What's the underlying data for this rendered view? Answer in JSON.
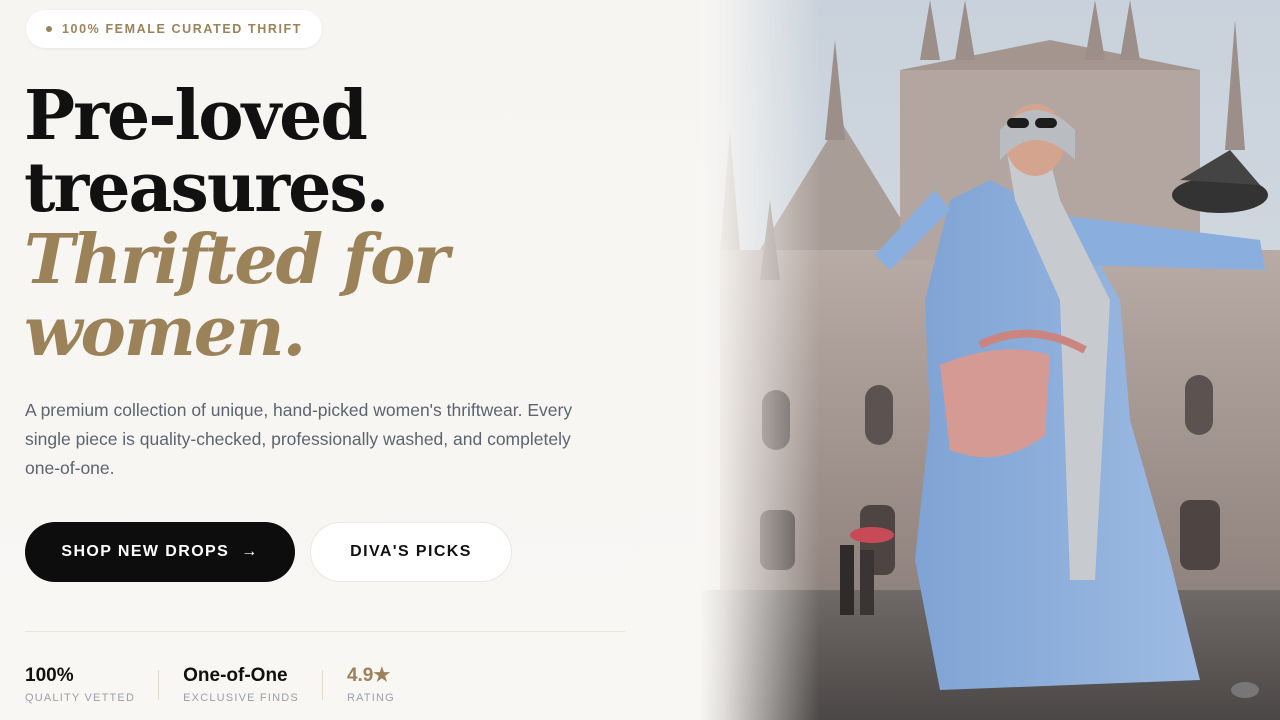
{
  "badge": {
    "text": "100% FEMALE CURATED THRIFT"
  },
  "hero": {
    "line1": "Pre-loved",
    "line2": "treasures.",
    "accent1": "Thrifted for",
    "accent2": "women.",
    "description": "A premium collection of unique, hand-picked women's thriftwear. Every single piece is quality-checked, professionally washed, and completely one-of-one."
  },
  "buttons": {
    "primary_label": "SHOP NEW DROPS",
    "primary_icon": "arrow-right-icon",
    "secondary_label": "DIVA'S PICKS"
  },
  "stats": [
    {
      "value": "100%",
      "label": "QUALITY VETTED"
    },
    {
      "value": "One-of-One",
      "label": "EXCLUSIVE FINDS"
    },
    {
      "value": "4.9★",
      "label": "RATING"
    }
  ],
  "colors": {
    "accent": "#9c8259",
    "dark": "#0d0d0d",
    "background": "#f8f6f3"
  }
}
